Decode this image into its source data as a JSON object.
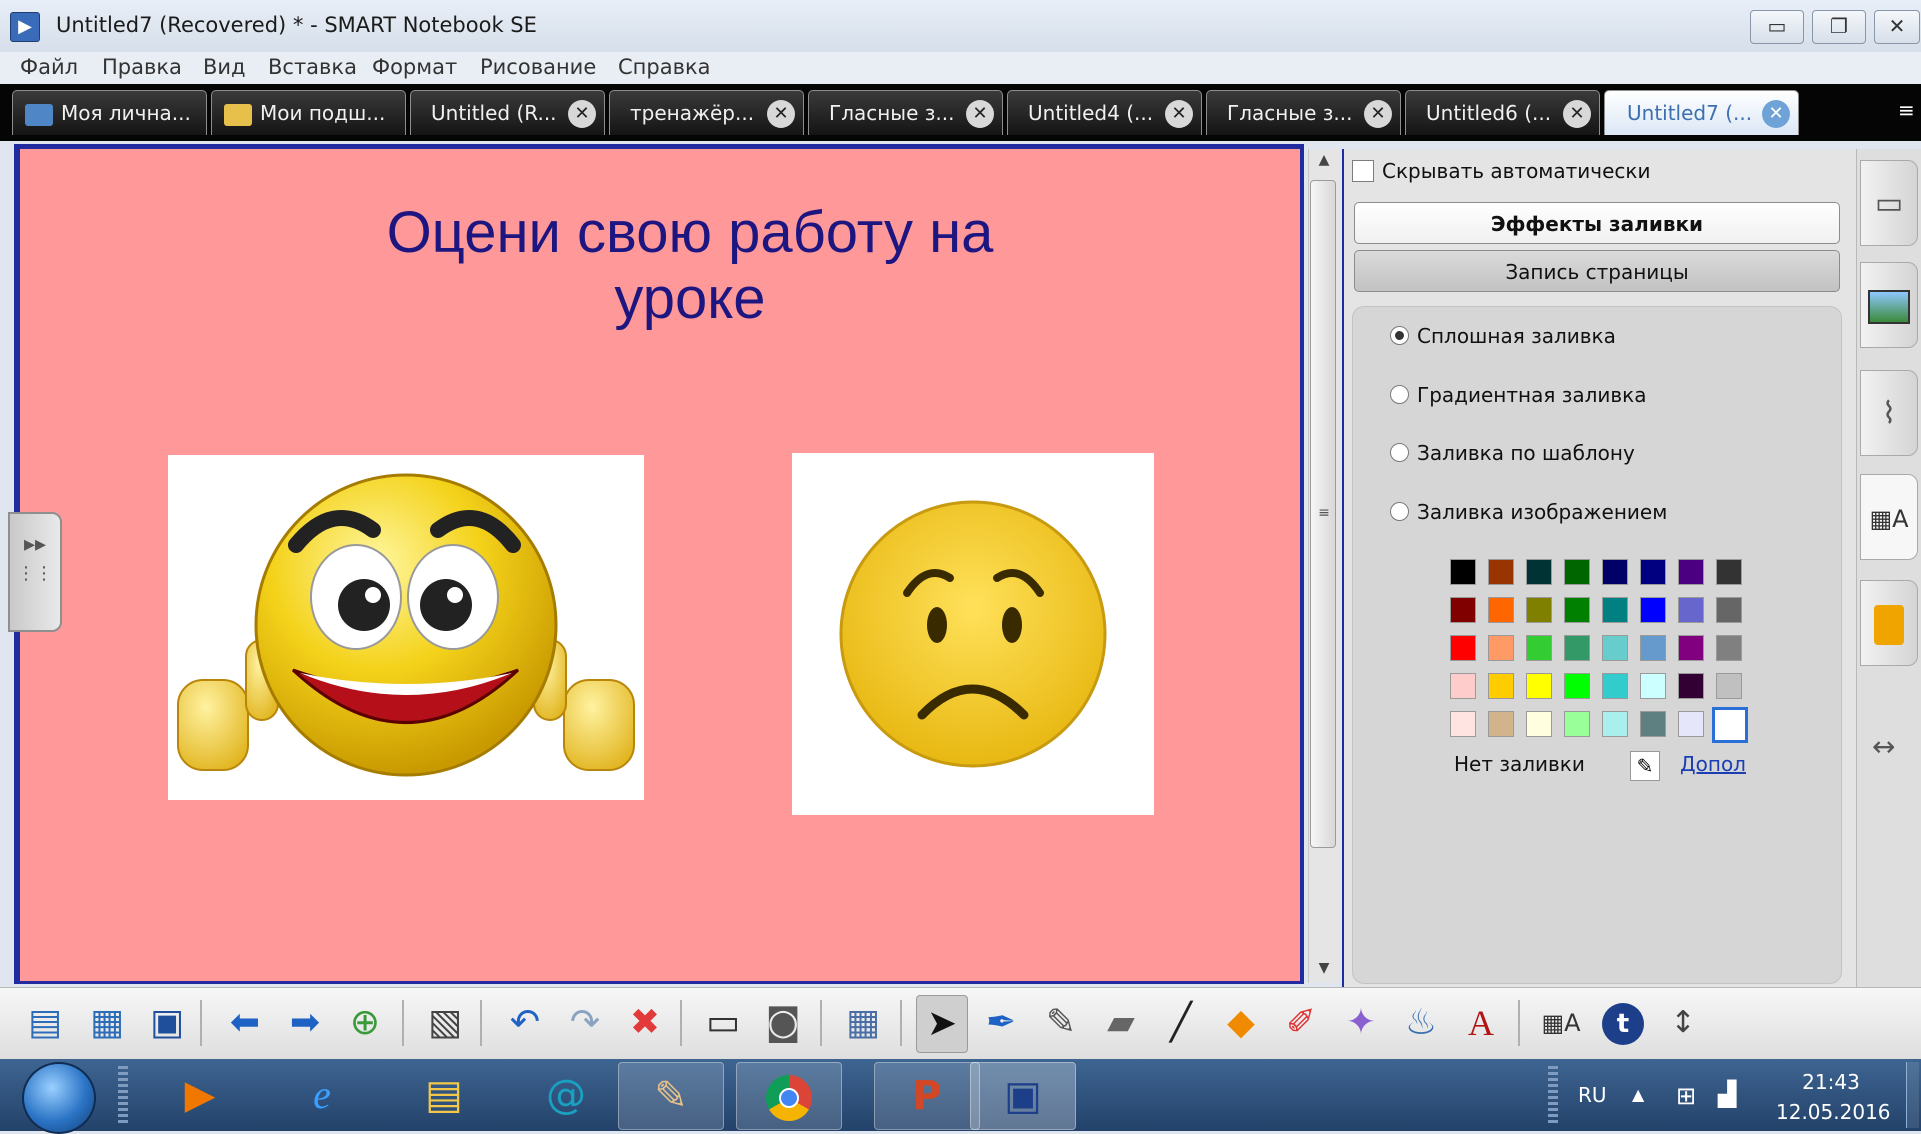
{
  "window": {
    "title": "Untitled7 (Recovered) * - SMART Notebook SE",
    "app_icon": "smart-notebook-icon",
    "controls": [
      "minimize",
      "restore",
      "close"
    ]
  },
  "menu": [
    "Файл",
    "Правка",
    "Вид",
    "Вставка",
    "Формат",
    "Рисование",
    "Справка"
  ],
  "tabs": [
    {
      "label": "Моя лична...",
      "icon": "home-icon",
      "closable": false,
      "active": false
    },
    {
      "label": "Мои подш...",
      "icon": "folder-icon",
      "closable": false,
      "active": false
    },
    {
      "label": "Untitled (R...",
      "closable": true,
      "active": false
    },
    {
      "label": "тренажёр...",
      "closable": true,
      "active": false
    },
    {
      "label": "Гласные з...",
      "closable": true,
      "active": false
    },
    {
      "label": "Untitled4 (...",
      "closable": true,
      "active": false
    },
    {
      "label": "Гласные з...",
      "closable": true,
      "active": false
    },
    {
      "label": "Untitled6 (...",
      "closable": true,
      "active": false
    },
    {
      "label": "Untitled7 (...",
      "closable": true,
      "active": true
    }
  ],
  "slide": {
    "title_line1": "Оцени свою работу на",
    "title_line2": "уроке",
    "background": "#ff9999",
    "title_color": "#1d1680",
    "images": [
      "happy-smiley-thumbs-up",
      "sad-smiley"
    ]
  },
  "panel": {
    "autohide_label": "Скрывать автоматически",
    "autohide_checked": false,
    "fill_effects_button": "Эффекты заливки",
    "page_recording_button": "Запись страницы",
    "fill_options": [
      {
        "label": "Сплошная заливка",
        "selected": true
      },
      {
        "label": "Градиентная заливка",
        "selected": false
      },
      {
        "label": "Заливка по шаблону",
        "selected": false
      },
      {
        "label": "Заливка изображением",
        "selected": false
      }
    ],
    "palette": [
      [
        "#000000",
        "#993300",
        "#003333",
        "#006600",
        "#000066",
        "#000080",
        "#4b0082",
        "#333333"
      ],
      [
        "#800000",
        "#ff6600",
        "#808000",
        "#008000",
        "#008080",
        "#0000ff",
        "#6666cc",
        "#666666"
      ],
      [
        "#ff0000",
        "#ff9966",
        "#33cc33",
        "#339966",
        "#66cccc",
        "#6699cc",
        "#800080",
        "#808080"
      ],
      [
        "#ffcccc",
        "#ffcc00",
        "#ffff00",
        "#00ff00",
        "#33cccc",
        "#ccffff",
        "#330033",
        "#c0c0c0"
      ],
      [
        "#ffe4e1",
        "#d2b48c",
        "#ffffe0",
        "#99ff99",
        "#aaeeee",
        "#5f8080",
        "#e6e6fa",
        "#ffffff"
      ]
    ],
    "selected_swatch": "#ffffff",
    "no_fill_label": "Нет заливки",
    "more_link": "Допол"
  },
  "strip_icons": [
    "page-sorter-icon",
    "gallery-icon",
    "attachments-icon",
    "properties-icon",
    "addons-icon",
    "move-panel-icon"
  ],
  "toolbar_icons": [
    "new-page-icon",
    "open-file-icon",
    "save-icon",
    "back-icon",
    "forward-icon",
    "add-page-icon",
    "paste-icon",
    "undo-icon",
    "redo-icon",
    "delete-icon",
    "show-hide-screen-icon",
    "screen-capture-icon",
    "table-icon",
    "select-icon",
    "pen-icon",
    "creative-pen-icon",
    "eraser-icon",
    "line-icon",
    "shapes-icon",
    "shape-recognition-pen-icon",
    "magic-pen-icon",
    "fill-icon",
    "text-icon",
    "properties-icon",
    "smart-response-icon",
    "toolbar-position-icon"
  ],
  "taskbar": {
    "apps": [
      "start-button",
      "media-player-icon",
      "internet-explorer-icon",
      "file-explorer-icon",
      "mail-icon",
      "paint-icon",
      "chrome-icon",
      "powerpoint-icon",
      "smart-notebook-icon"
    ],
    "language": "RU",
    "time": "21:43",
    "date": "12.05.2016"
  }
}
